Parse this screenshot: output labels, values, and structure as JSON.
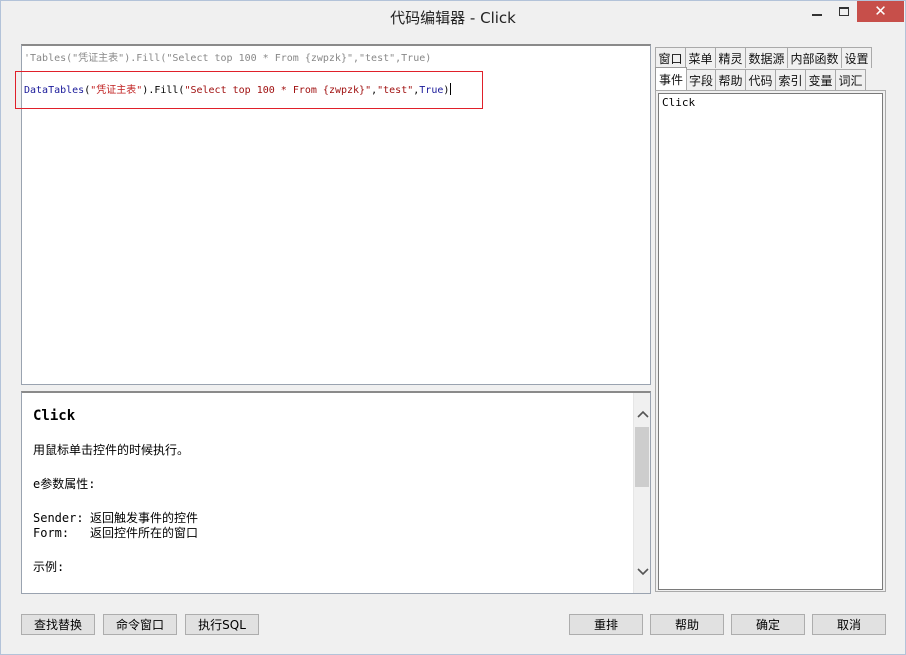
{
  "window": {
    "title": "代码编辑器 - Click"
  },
  "editor": {
    "line1": "'Tables(\"凭证主表\").Fill(\"Select top 100 * From {zwpzk}\",\"test\",True)",
    "line2": {
      "ident": "DataTables",
      "p1": "(",
      "str1": "\"凭证主表\"",
      "mid": ").Fill(",
      "str2": "\"Select top 100 * From {zwpzk}\"",
      "comma1": ",",
      "str3": "\"test\"",
      "comma2": ",",
      "kw": "True",
      "end": ")"
    }
  },
  "help": {
    "title": "Click",
    "description": "用鼠标单击控件的时候执行。",
    "params_heading": "e参数属性:",
    "params": [
      {
        "key": "Sender:",
        "value": "返回触发事件的控件"
      },
      {
        "key": "Form:",
        "value": "返回控件所在的窗口"
      }
    ],
    "example_heading": "示例:"
  },
  "tabs": {
    "row1": [
      "窗口",
      "菜单",
      "精灵",
      "数据源",
      "内部函数",
      "设置"
    ],
    "row2": [
      "事件",
      "字段",
      "帮助",
      "代码",
      "索引",
      "变量",
      "词汇"
    ],
    "active": "事件"
  },
  "event_list": [
    "Click"
  ],
  "buttons": {
    "find_replace": "查找替换",
    "command_window": "命令窗口",
    "execute_sql": "执行SQL",
    "rearrange": "重排",
    "help": "帮助",
    "ok": "确定",
    "cancel": "取消"
  },
  "colors": {
    "highlight_border": "#e0202a",
    "close_button": "#c74f4a"
  }
}
